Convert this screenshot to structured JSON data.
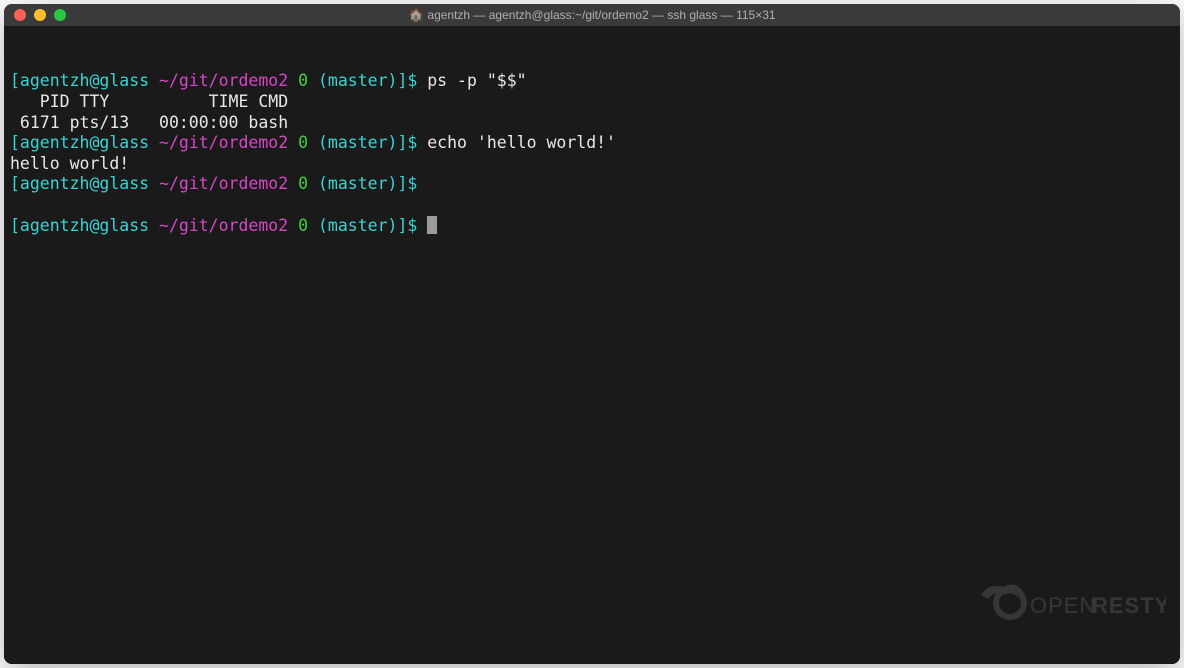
{
  "window": {
    "title": "agentzh — agentzh@glass:~/git/ordemo2 — ssh glass — 115×31",
    "title_icon": "🏠"
  },
  "prompt": {
    "bracket_open": "[",
    "user_host": "agentzh@glass",
    "path": "~/git/ordemo2",
    "status": "0",
    "branch": "(master)",
    "bracket_close": "]$"
  },
  "session": {
    "lines": [
      {
        "type": "prompt",
        "command": "ps -p \"$$\""
      },
      {
        "type": "output",
        "text": "   PID TTY          TIME CMD"
      },
      {
        "type": "output",
        "text": " 6171 pts/13   00:00:00 bash"
      },
      {
        "type": "prompt",
        "command": "echo 'hello world!'"
      },
      {
        "type": "output",
        "text": "hello world!"
      },
      {
        "type": "prompt",
        "command": ""
      },
      {
        "type": "blank",
        "text": ""
      },
      {
        "type": "prompt-cursor",
        "command": ""
      }
    ]
  },
  "watermark": {
    "text": "OPENRESTY"
  }
}
